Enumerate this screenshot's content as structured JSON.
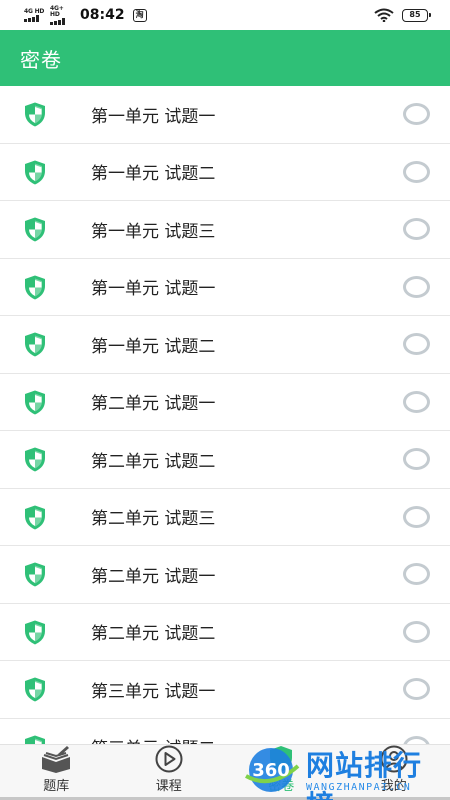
{
  "status_bar": {
    "network_1": "4G HD",
    "network_2": "4G+ HD",
    "time": "08:42",
    "notification_badge": "淘",
    "battery": "85"
  },
  "app_bar": {
    "title": "密卷",
    "color": "#2fc077"
  },
  "list": {
    "items": [
      {
        "label": "第一单元 试题一",
        "icon": "shield-icon"
      },
      {
        "label": "第一单元 试题二",
        "icon": "shield-icon"
      },
      {
        "label": "第一单元 试题三",
        "icon": "shield-icon"
      },
      {
        "label": "第一单元 试题一",
        "icon": "shield-icon"
      },
      {
        "label": "第一单元 试题二",
        "icon": "shield-icon"
      },
      {
        "label": "第二单元 试题一",
        "icon": "shield-icon"
      },
      {
        "label": "第二单元 试题二",
        "icon": "shield-icon"
      },
      {
        "label": "第二单元 试题三",
        "icon": "shield-icon"
      },
      {
        "label": "第二单元 试题一",
        "icon": "shield-icon"
      },
      {
        "label": "第二单元 试题二",
        "icon": "shield-icon"
      },
      {
        "label": "第三单元 试题一",
        "icon": "shield-icon"
      },
      {
        "label": "第三单元 试题二",
        "icon": "shield-icon"
      }
    ]
  },
  "bottom_nav": {
    "items": [
      {
        "label": "题库",
        "icon": "book-icon"
      },
      {
        "label": "课程",
        "icon": "play-icon"
      },
      {
        "label": "密卷",
        "icon": "shield-icon",
        "active": true
      },
      {
        "label": "我的",
        "icon": "person-icon"
      }
    ]
  },
  "watermark": {
    "logo_text": "360",
    "text": "网站排行榜",
    "sub": "WANGZHANPAI.CN"
  }
}
